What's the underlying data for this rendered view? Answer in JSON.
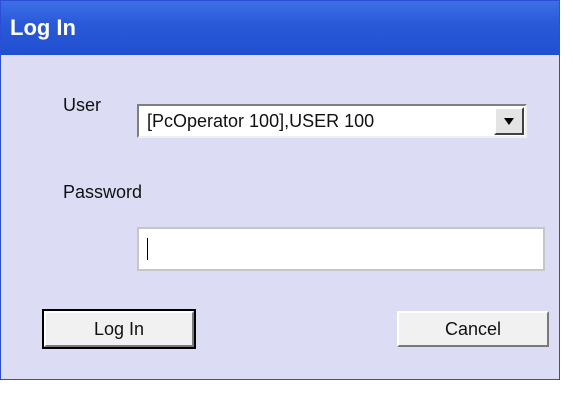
{
  "window": {
    "title": "Log In"
  },
  "form": {
    "user_label": "User",
    "user_value": "[PcOperator 100],USER 100",
    "password_label": "Password",
    "password_value": ""
  },
  "buttons": {
    "login_label": "Log In",
    "cancel_label": "Cancel"
  },
  "icons": {
    "dropdown": "chevron-down-icon"
  },
  "colors": {
    "titlebar": "#2b5ad8",
    "dialog_background": "#dcdcf5"
  }
}
